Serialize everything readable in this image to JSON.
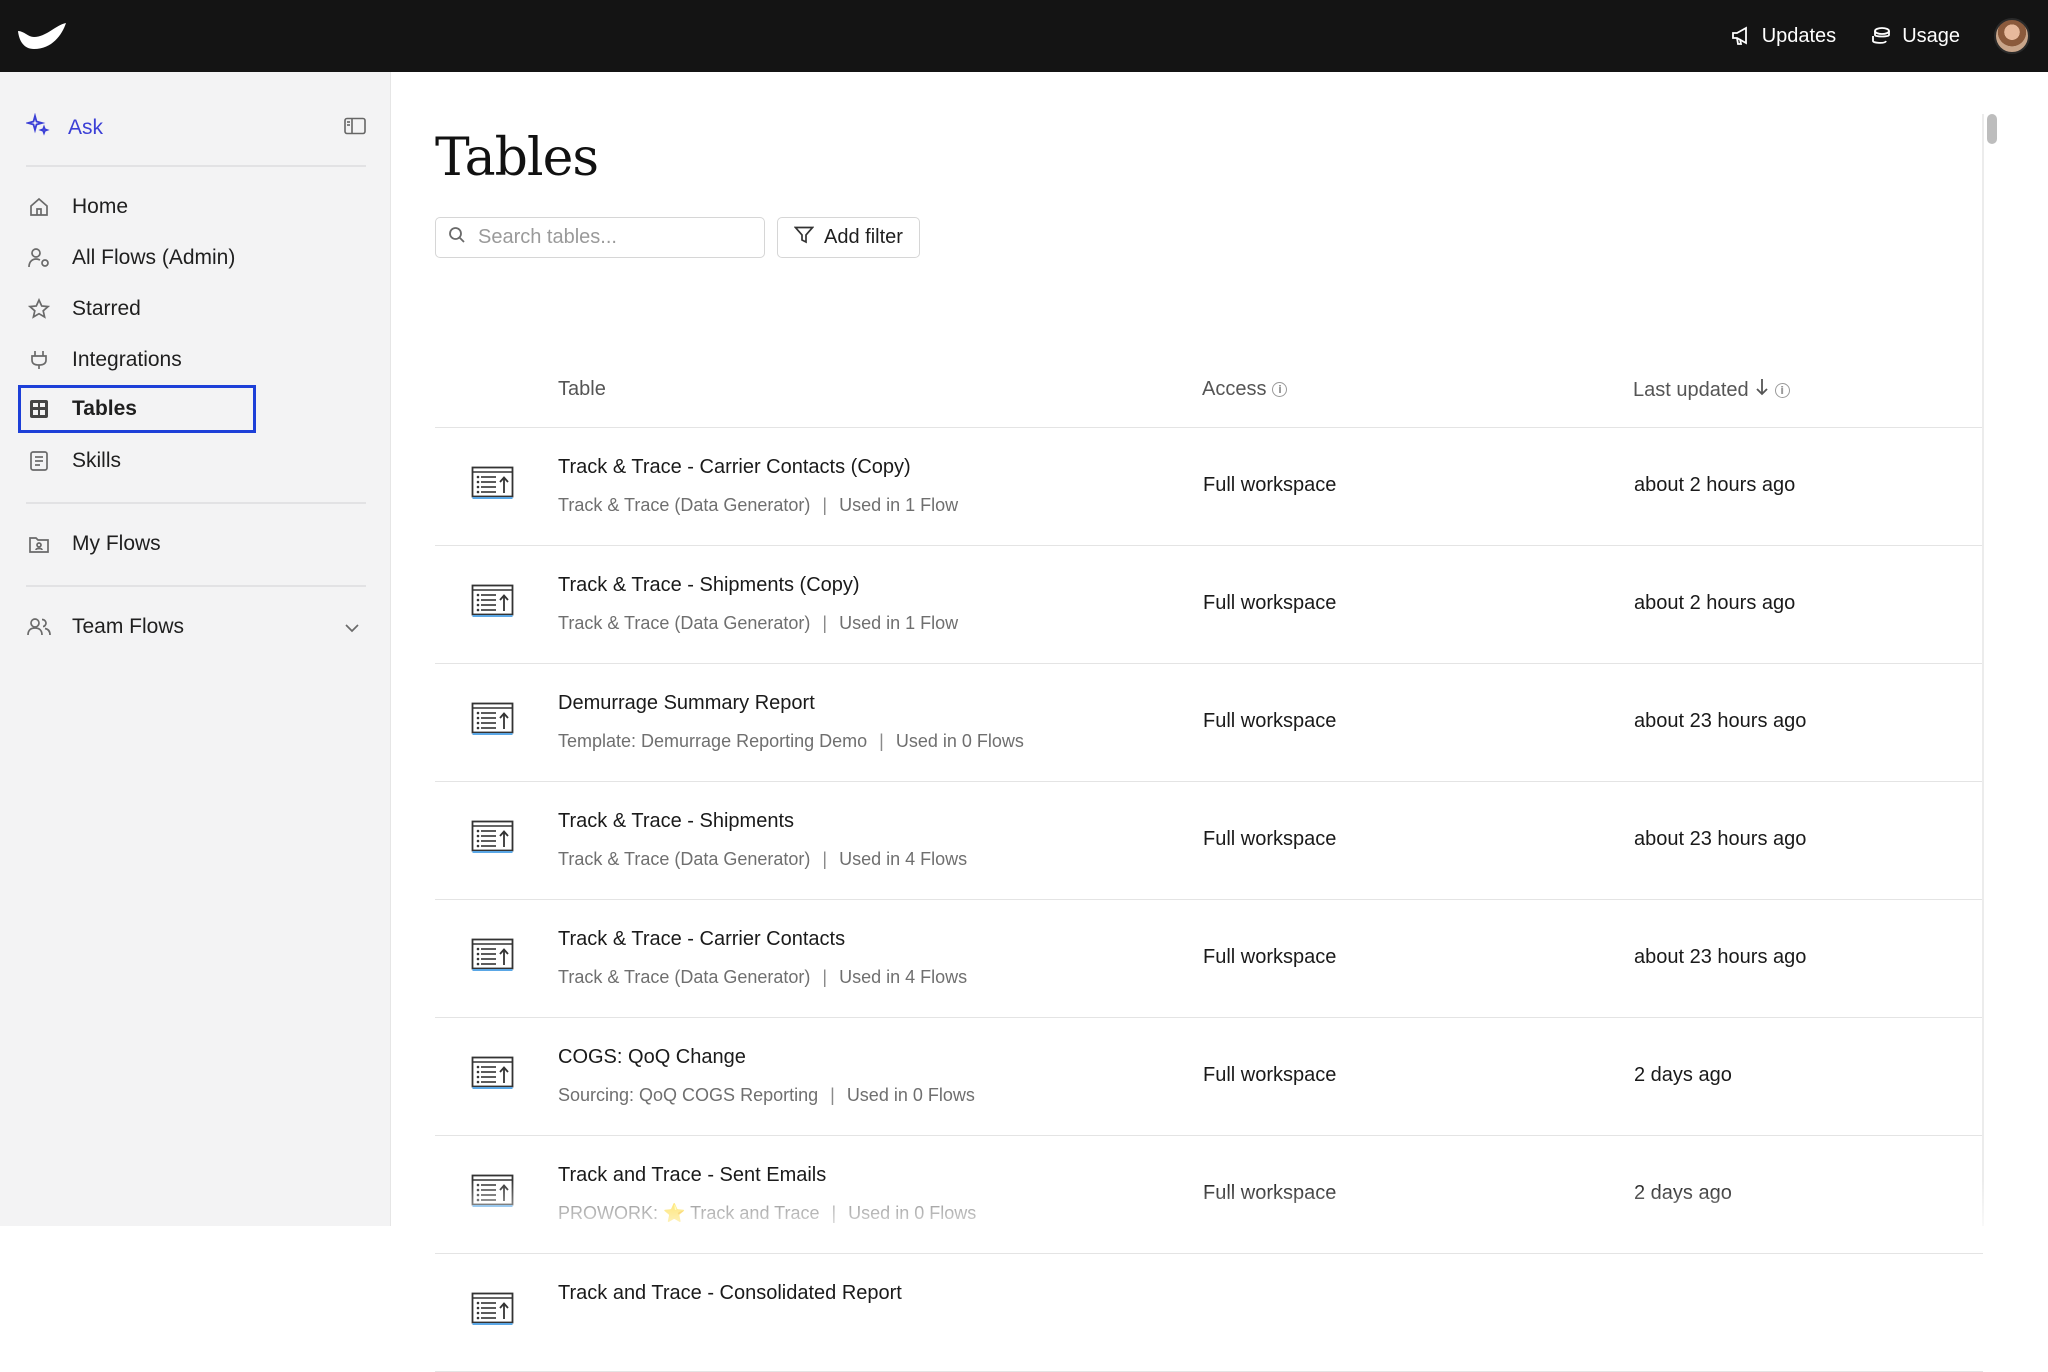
{
  "topbar": {
    "updates_label": "Updates",
    "usage_label": "Usage"
  },
  "sidebar": {
    "ask_label": "Ask",
    "items": [
      {
        "label": "Home",
        "icon": "home-icon"
      },
      {
        "label": "All Flows (Admin)",
        "icon": "user-gear-icon"
      },
      {
        "label": "Starred",
        "icon": "star-icon"
      },
      {
        "label": "Integrations",
        "icon": "plug-icon"
      },
      {
        "label": "Tables",
        "icon": "table-icon",
        "active": true
      },
      {
        "label": "Skills",
        "icon": "document-icon"
      }
    ],
    "my_flows_label": "My Flows",
    "team_flows_label": "Team Flows"
  },
  "main": {
    "title": "Tables",
    "search_placeholder": "Search tables...",
    "filter_label": "Add filter",
    "columns": {
      "table": "Table",
      "access": "Access",
      "last_updated": "Last updated"
    },
    "rows": [
      {
        "name": "Track & Trace - Carrier Contacts (Copy)",
        "source": "Track & Trace (Data Generator)",
        "usage": "Used in 1 Flow",
        "access": "Full workspace",
        "updated": "about 2 hours ago"
      },
      {
        "name": "Track & Trace - Shipments (Copy)",
        "source": "Track & Trace (Data Generator)",
        "usage": "Used in 1 Flow",
        "access": "Full workspace",
        "updated": "about 2 hours ago"
      },
      {
        "name": "Demurrage Summary Report",
        "source": "Template: Demurrage Reporting Demo",
        "usage": "Used in 0 Flows",
        "access": "Full workspace",
        "updated": "about 23 hours ago"
      },
      {
        "name": "Track & Trace - Shipments",
        "source": "Track & Trace (Data Generator)",
        "usage": "Used in 4 Flows",
        "access": "Full workspace",
        "updated": "about 23 hours ago"
      },
      {
        "name": "Track & Trace - Carrier Contacts",
        "source": "Track & Trace (Data Generator)",
        "usage": "Used in 4 Flows",
        "access": "Full workspace",
        "updated": "about 23 hours ago"
      },
      {
        "name": "COGS: QoQ Change",
        "source": "Sourcing: QoQ COGS Reporting",
        "usage": "Used in 0 Flows",
        "access": "Full workspace",
        "updated": "2 days ago"
      },
      {
        "name": "Track and Trace - Sent Emails",
        "source": "PROWORK: ⭐ Track and Trace",
        "usage": "Used in 0 Flows",
        "access": "Full workspace",
        "updated": "2 days ago"
      },
      {
        "name": "Track and Trace - Consolidated Report",
        "source": "",
        "usage": "",
        "access": "",
        "updated": ""
      }
    ]
  },
  "colors": {
    "topbar_bg": "#141414",
    "sidebar_bg": "#f3f3f4",
    "accent": "#3b3fd6",
    "active_outline": "#1d3fd8"
  }
}
